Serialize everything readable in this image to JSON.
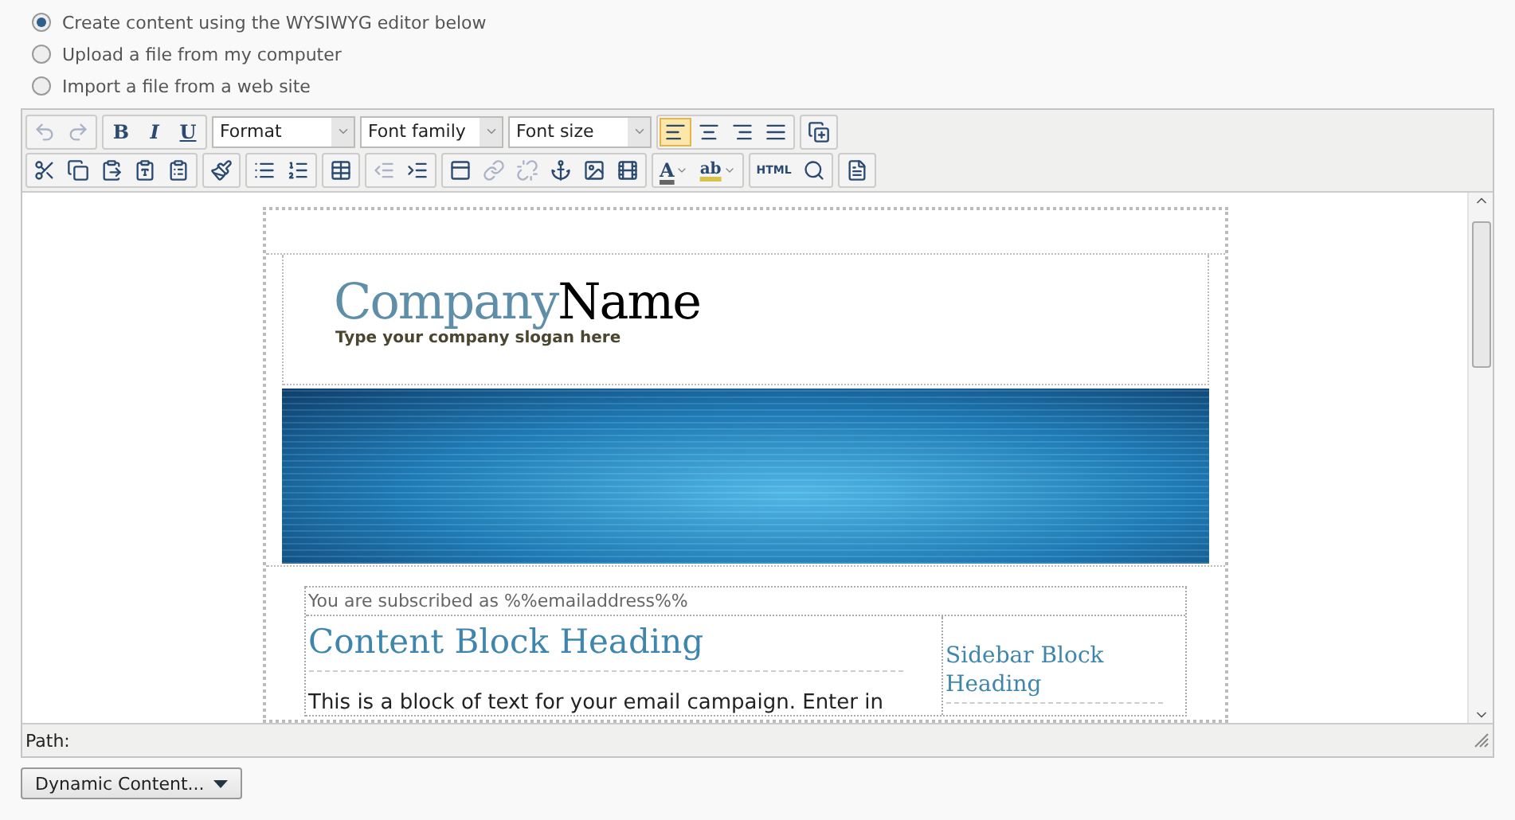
{
  "options": [
    {
      "label": "Create content using the WYSIWYG editor below",
      "selected": true
    },
    {
      "label": "Upload a file from my computer",
      "selected": false
    },
    {
      "label": "Import a file from a web site",
      "selected": false
    }
  ],
  "toolbar": [
    [
      [
        {
          "kind": "undo",
          "disabled": true
        },
        {
          "kind": "redo",
          "disabled": true
        }
      ],
      [
        {
          "kind": "bold",
          "label": "B",
          "disabled": false
        },
        {
          "kind": "italic",
          "label": "I",
          "disabled": false
        },
        {
          "kind": "underline",
          "label": "U",
          "disabled": false
        }
      ],
      [
        {
          "kind": "select",
          "label": "Format"
        },
        {
          "kind": "select",
          "label": "Font family"
        },
        {
          "kind": "select",
          "label": "Font size"
        }
      ],
      [
        {
          "kind": "align-left",
          "disabled": false,
          "selected": true
        },
        {
          "kind": "align-center",
          "disabled": false,
          "selected": false
        },
        {
          "kind": "align-right",
          "disabled": false,
          "selected": false
        },
        {
          "kind": "align-justify",
          "disabled": false,
          "selected": false
        }
      ],
      [
        {
          "kind": "layer",
          "disabled": false
        }
      ]
    ],
    [
      [
        {
          "kind": "cut",
          "disabled": false
        },
        {
          "kind": "copy",
          "disabled": false
        },
        {
          "kind": "paste",
          "disabled": false
        },
        {
          "kind": "paste-text",
          "disabled": false
        },
        {
          "kind": "paste-word",
          "disabled": false
        }
      ],
      [
        {
          "kind": "cleanup",
          "disabled": false
        }
      ],
      [
        {
          "kind": "bullets",
          "disabled": false
        },
        {
          "kind": "numbers",
          "disabled": false
        }
      ],
      [
        {
          "kind": "table",
          "disabled": false
        }
      ],
      [
        {
          "kind": "outdent",
          "disabled": true
        },
        {
          "kind": "indent",
          "disabled": false
        }
      ],
      [
        {
          "kind": "template",
          "disabled": false
        },
        {
          "kind": "link",
          "disabled": true
        },
        {
          "kind": "unlink",
          "disabled": true
        },
        {
          "kind": "anchor",
          "disabled": false
        },
        {
          "kind": "image",
          "disabled": false
        },
        {
          "kind": "media",
          "disabled": false
        }
      ],
      [
        {
          "kind": "text-color",
          "label": "A",
          "disabled": false
        },
        {
          "kind": "highlight",
          "label": "ab",
          "disabled": false
        }
      ],
      [
        {
          "kind": "html",
          "label": "HTML",
          "disabled": false
        },
        {
          "kind": "preview",
          "disabled": false
        }
      ],
      [
        {
          "kind": "page",
          "disabled": false
        }
      ]
    ]
  ],
  "email": {
    "logo_light": "Company",
    "logo_dark": "Name",
    "slogan": "Type your company slogan here",
    "subscribed": "You are subscribed as %%emailaddress%%",
    "heading": "Content Block Heading",
    "body": "This is a block of text for your email campaign. Enter in",
    "sidebar_heading": "Sidebar Block Heading"
  },
  "path_label": "Path:",
  "dynamic_button": "Dynamic Content..."
}
